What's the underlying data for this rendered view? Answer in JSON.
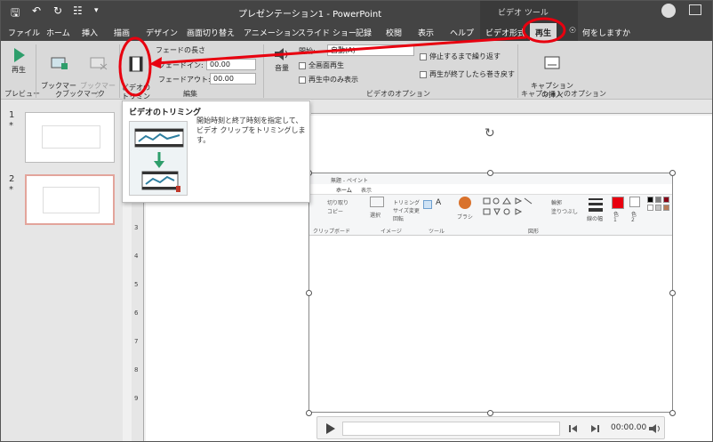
{
  "titlebar": {
    "title": "プレゼンテーション1 - PowerPoint",
    "context": "ビデオ ツール"
  },
  "tabs": [
    "ファイル",
    "ホーム",
    "挿入",
    "描画",
    "デザイン",
    "画面切り替え",
    "アニメーション",
    "スライド ショー",
    "記録",
    "校閲",
    "表示",
    "ヘルプ",
    "ビデオ形式",
    "再生"
  ],
  "tell_me": "何をしますか",
  "ribbon": {
    "preview": {
      "play_label": "再生",
      "group": "プレビュー"
    },
    "bookmarks": {
      "add_label": "ブックマーク\nの追加",
      "remove_label": "ブックマーク\nの削除",
      "group": "ブックマーク"
    },
    "editing": {
      "trim_label": "ビデオの\nトリミング",
      "fade_duration": "フェードの長さ",
      "fade_in_label": "フェードイン:",
      "fade_in_value": "00.00",
      "fade_out_label": "フェードアウト:",
      "fade_out_value": "00.00",
      "group": "編集"
    },
    "video_options": {
      "volume_label": "音量",
      "start_label": "開始:",
      "start_value": "自動(A)",
      "fullscreen": "全画面再生",
      "hide_not_playing": "再生中のみ表示",
      "loop": "停止するまで繰り返す",
      "rewind": "再生が終了したら巻き戻す",
      "group": "ビデオのオプション"
    },
    "caption": {
      "insert_label": "キャプション\nの挿入",
      "group": "キャプションのオプション"
    }
  },
  "tooltip": {
    "title": "ビデオのトリミング",
    "description": "開始時刻と終了時刻を指定して、ビデオ クリップをトリミングします。"
  },
  "slides": [
    {
      "number": "1",
      "marker": "*"
    },
    {
      "number": "2",
      "marker": "*"
    }
  ],
  "paint_video": {
    "window_title": "無題 - ペイント",
    "tabs": [
      "ホーム",
      "表示"
    ],
    "clipboard_group": "クリップボード",
    "image_group": "イメージ",
    "tools_group": "ツール",
    "shapes_group": "図形",
    "select_label": "選択",
    "crop_label": "トリミング",
    "resize_label": "サイズ変更",
    "rotate_label": "回転",
    "cut_label": "切り取り",
    "copy_label": "コピー",
    "brush_label": "ブラシ",
    "outline_label": "輪郭",
    "fill_label": "塗りつぶし",
    "size_label": "線の幅",
    "color1_label": "色\n1",
    "color2_label": "色\n2"
  },
  "player": {
    "time": "00:00.00"
  },
  "ruler_numbers": [
    "9",
    "8",
    "7",
    "6",
    "5",
    "4",
    "3",
    "2",
    "1"
  ],
  "colors": {
    "accent_red": "#e8000f",
    "title_bar": "#444444",
    "ribbon": "#d9d9d9",
    "play_green": "#2e9e6b"
  }
}
